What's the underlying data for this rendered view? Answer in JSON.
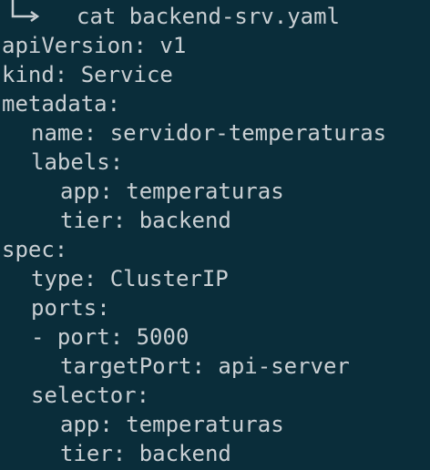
{
  "terminal": {
    "command": "cat backend-srv.yaml",
    "lines": [
      "apiVersion: v1",
      "kind: Service",
      "metadata:",
      "name: servidor-temperaturas",
      "labels:",
      "app: temperaturas",
      "tier: backend",
      "spec:",
      "type: ClusterIP",
      "ports:",
      "- port: 5000",
      "targetPort: api-server",
      "selector:",
      "app: temperaturas",
      "tier: backend"
    ]
  },
  "icons": {
    "prompt": "prompt-arrow-icon"
  },
  "colors": {
    "background": "#0a2d3a",
    "text": "#c9cfd3"
  }
}
